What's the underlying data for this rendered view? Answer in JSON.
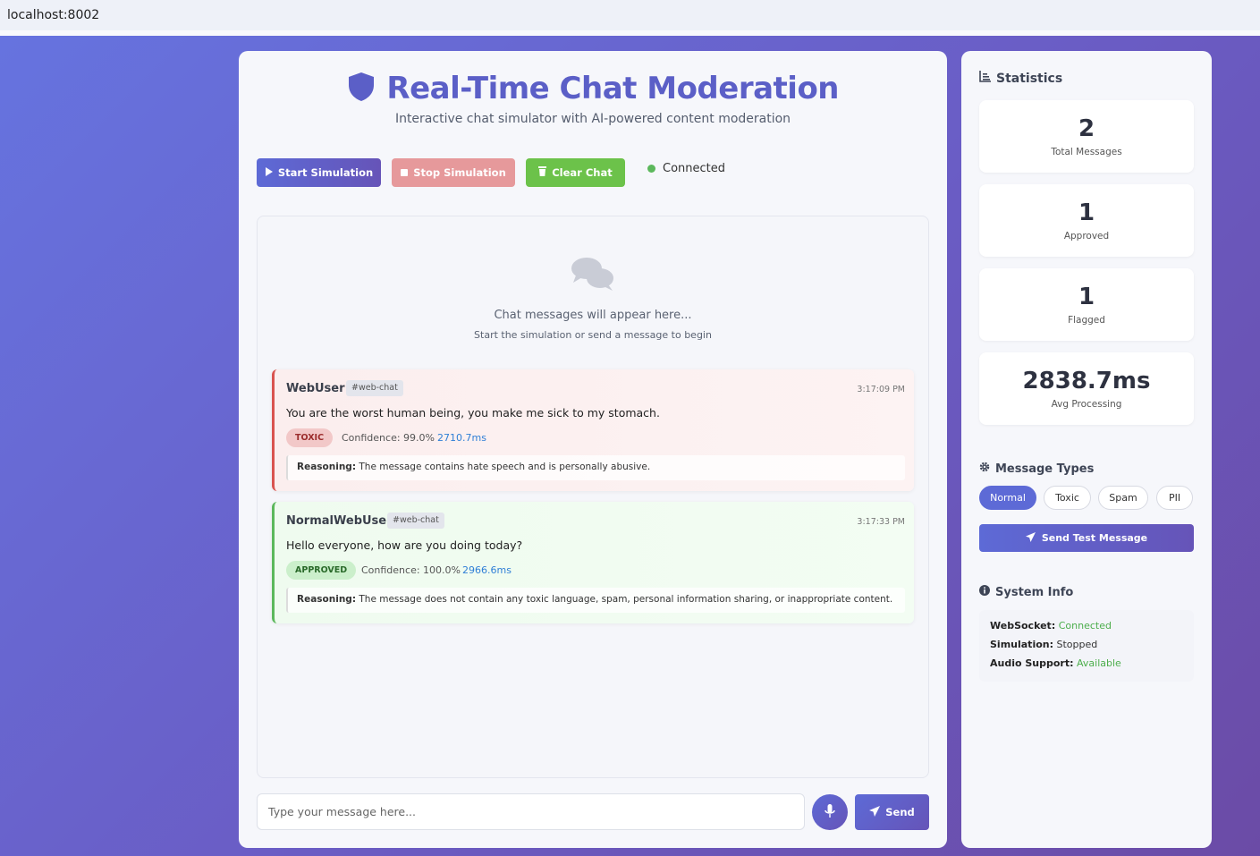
{
  "browser": {
    "url": "localhost:8002"
  },
  "header": {
    "title": "Real-Time Chat Moderation",
    "subtitle": "Interactive chat simulator with AI-powered content moderation"
  },
  "controls": {
    "start_label": "Start Simulation",
    "stop_label": "Stop Simulation",
    "clear_label": "Clear Chat",
    "connection_status": "Connected"
  },
  "chat": {
    "placeholder_main": "Chat messages will appear here...",
    "placeholder_sub": "Start the simulation or send a message to begin",
    "messages": [
      {
        "user": "WebUser",
        "channel": "#web-chat",
        "time": "3:17:09 PM",
        "text": "You are the worst human being, you make me sick to my stomach.",
        "status": "TOXIC",
        "confidence": "Confidence: 99.0%",
        "processing": "2710.7ms",
        "reasoning_label": "Reasoning:",
        "reasoning": "The message contains hate speech and is personally abusive."
      },
      {
        "user": "NormalWebUser",
        "channel": "#web-chat",
        "time": "3:17:33 PM",
        "text": "Hello everyone, how are you doing today?",
        "status": "APPROVED",
        "confidence": "Confidence: 100.0%",
        "processing": "2966.6ms",
        "reasoning_label": "Reasoning:",
        "reasoning": "The message does not contain any toxic language, spam, personal information sharing, or inappropriate content."
      }
    ]
  },
  "input": {
    "placeholder": "Type your message here...",
    "value": "",
    "send_label": "Send"
  },
  "stats": {
    "title": "Statistics",
    "items": [
      {
        "value": "2",
        "label": "Total Messages"
      },
      {
        "value": "1",
        "label": "Approved"
      },
      {
        "value": "1",
        "label": "Flagged"
      },
      {
        "value": "2838.7ms",
        "label": "Avg Processing"
      }
    ]
  },
  "message_types": {
    "title": "Message Types",
    "options": [
      "Normal",
      "Toxic",
      "Spam",
      "PII"
    ],
    "selected": "Normal",
    "send_test_label": "Send Test Message"
  },
  "system_info": {
    "title": "System Info",
    "websocket_label": "WebSocket:",
    "websocket_value": "Connected",
    "simulation_label": "Simulation:",
    "simulation_value": "Stopped",
    "audio_label": "Audio Support:",
    "audio_value": "Available"
  },
  "colors": {
    "accent": "#5d6ad6",
    "toxic": "#d9534f",
    "approved": "#5cb85c",
    "status_green": "#4cae4c",
    "processing_blue": "#2f7fd6"
  },
  "icons": [
    "shield-icon",
    "play-icon",
    "stop-icon",
    "trash-icon",
    "chat-bubbles-icon",
    "microphone-icon",
    "paper-plane-icon",
    "chart-icon",
    "gear-icon",
    "info-icon"
  ]
}
